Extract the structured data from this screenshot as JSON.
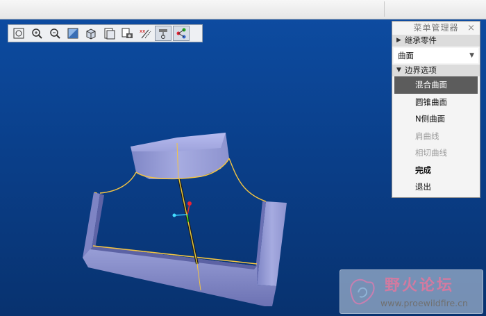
{
  "menu_manager": {
    "title": "菜单管理器",
    "close": "×",
    "sections": {
      "inherit": "继承零件",
      "boundary": "边界选项"
    },
    "select_value": "曲面",
    "items": [
      {
        "label": "混合曲面",
        "state": "selected"
      },
      {
        "label": "圆锥曲面",
        "state": "normal"
      },
      {
        "label": "N侧曲面",
        "state": "normal"
      },
      {
        "label": "肩曲线",
        "state": "disabled"
      },
      {
        "label": "相切曲线",
        "state": "disabled"
      },
      {
        "label": "完成",
        "state": "bold"
      },
      {
        "label": "退出",
        "state": "normal"
      }
    ]
  },
  "toolbar": {
    "buttons": [
      {
        "icon": "refit-zoom-icon",
        "active": false
      },
      {
        "icon": "zoom-in-icon",
        "active": false
      },
      {
        "icon": "zoom-out-icon",
        "active": false
      },
      {
        "icon": "repaint-icon",
        "active": false
      },
      {
        "icon": "display-style-icon",
        "active": false
      },
      {
        "icon": "saved-views-icon",
        "active": false
      },
      {
        "icon": "view-manager-icon",
        "active": false
      },
      {
        "icon": "datum-display-icon",
        "active": false
      },
      {
        "icon": "annotation-display-icon",
        "active": true
      },
      {
        "icon": "spin-center-icon",
        "active": true
      }
    ]
  },
  "watermark": {
    "title": "野火论坛",
    "url": "www.proewildfire.cn"
  },
  "colors": {
    "viewport_top": "#0d4ba0",
    "viewport_bottom": "#08326f",
    "surface": "#9aa0d8",
    "edge": "#f5c542",
    "selected_item": "#5c5c5c"
  }
}
